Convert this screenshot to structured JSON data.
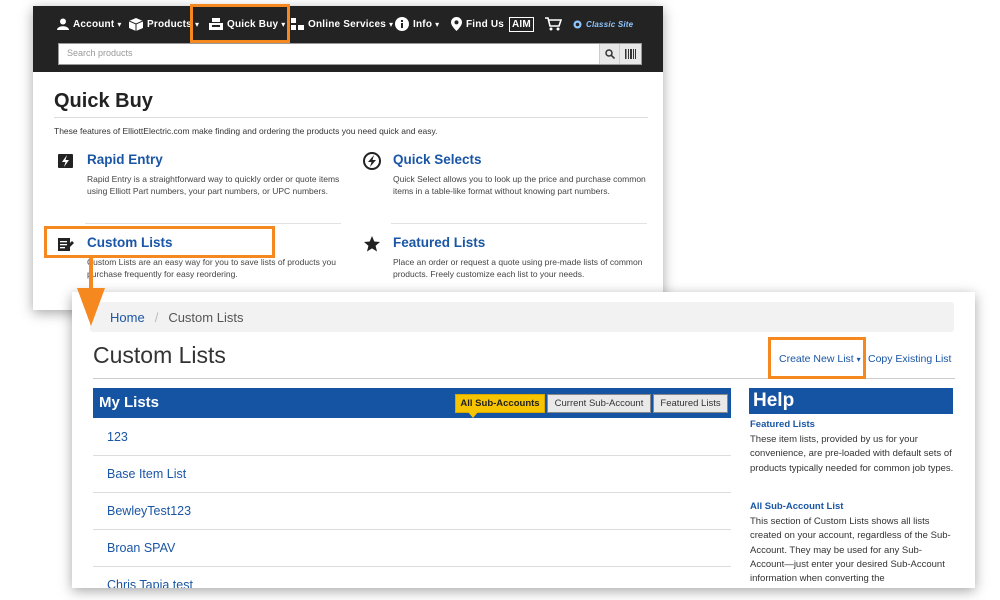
{
  "nav": {
    "account": "Account",
    "products": "Products",
    "quick_buy": "Quick Buy",
    "online_services": "Online Services",
    "info": "Info",
    "find_us": "Find Us",
    "aim": "AIM",
    "classic_site": "Classic Site"
  },
  "search": {
    "placeholder": "Search products"
  },
  "quick_buy_page": {
    "title": "Quick Buy",
    "intro": "These features of ElliottElectric.com make finding and ordering the products you need quick and easy.",
    "features": [
      {
        "title": "Rapid Entry",
        "desc": "Rapid Entry is a straightforward way to quickly order or quote items using Elliott Part numbers, your part numbers, or UPC numbers.",
        "icon": "lightning-box-icon"
      },
      {
        "title": "Quick Selects",
        "desc": "Quick Select allows you to look up the price and purchase common items in a table-like format without knowing part numbers.",
        "icon": "lightning-circle-icon"
      },
      {
        "title": "Custom Lists",
        "desc": "Custom Lists are an easy way for you to save lists of products you purchase frequently for easy reordering.",
        "icon": "edit-list-icon"
      },
      {
        "title": "Featured Lists",
        "desc": "Place an order or request a quote using pre-made lists of common products. Freely customize each list to your needs.",
        "icon": "star-icon"
      }
    ]
  },
  "breadcrumb": {
    "home": "Home",
    "current": "Custom Lists"
  },
  "custom_lists": {
    "title": "Custom Lists",
    "create_new": "Create New List",
    "copy_existing": "Copy Existing List",
    "my_lists_title": "My Lists",
    "tabs": [
      "All Sub-Accounts",
      "Current Sub-Account",
      "Featured Lists"
    ],
    "lists": [
      "123",
      "Base Item List",
      "BewleyTest123",
      "Broan SPAV",
      "Chris Tapia test"
    ]
  },
  "help": {
    "title": "Help",
    "sections": [
      {
        "heading": "Featured Lists",
        "text": "These item lists, provided by us for your convenience, are pre-loaded with default sets of products typically needed for common job types."
      },
      {
        "heading": "All Sub-Account List",
        "text": "This section of Custom Lists shows all lists created on your account, regardless of the Sub-Account. They may be used for any Sub-Account—just enter your desired Sub-Account information when converting the"
      }
    ]
  },
  "colors": {
    "accent": "#f5891f",
    "nav_bg": "#232323",
    "brand_blue": "#1553a3",
    "link": "#1a56a5",
    "tab_active": "#f7c400"
  }
}
